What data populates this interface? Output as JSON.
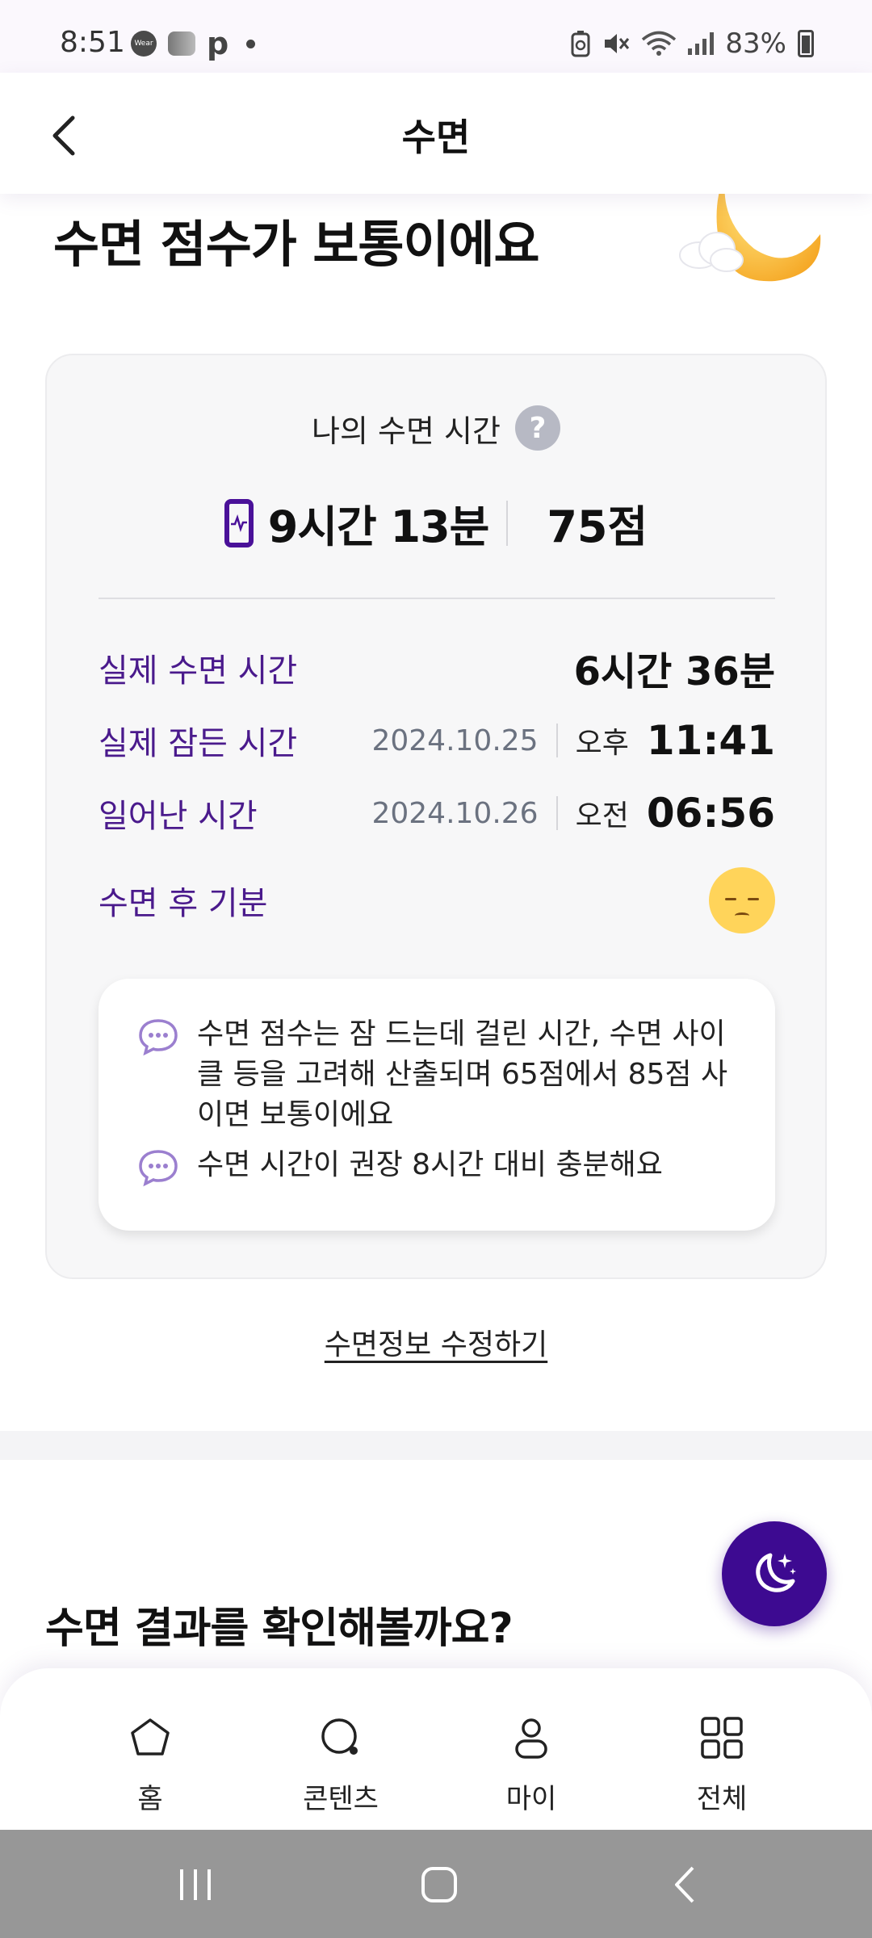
{
  "status_bar": {
    "time": "8:51",
    "wear_icon_text": "Wear",
    "p_icon_text": "p",
    "battery_percent": "83%"
  },
  "header": {
    "title": "수면"
  },
  "headline": "수면 점수가 보통이에요",
  "card": {
    "title": "나의 수면 시간",
    "help_icon_text": "?",
    "total_duration": "9시간 13분",
    "score": "75점",
    "rows": [
      {
        "label": "실제 수면 시간",
        "value": "6시간 36분"
      },
      {
        "label": "실제 잠든 시간",
        "date": "2024.10.25",
        "ampm": "오후",
        "time": "11:41"
      },
      {
        "label": "일어난 시간",
        "date": "2024.10.26",
        "ampm": "오전",
        "time": "06:56"
      },
      {
        "label": "수면 후 기분",
        "mood": "sad-face"
      }
    ],
    "tips": [
      "수면 점수는 잠 드는데 걸린 시간, 수면 사이클 등을 고려해 산출되며 65점에서 85점 사이면 보통이에요",
      "수면 시간이 권장 8시간 대비 충분해요"
    ]
  },
  "edit_link": "수면정보 수정하기",
  "section_title": "수면 결과를 확인해볼까요?",
  "bottom_nav": [
    {
      "label": "홈",
      "icon": "home-icon"
    },
    {
      "label": "콘텐츠",
      "icon": "search-icon"
    },
    {
      "label": "마이",
      "icon": "person-icon"
    },
    {
      "label": "전체",
      "icon": "grid-icon"
    }
  ],
  "colors": {
    "accent": "#3d0a91",
    "label_purple": "#4a1a8c"
  }
}
